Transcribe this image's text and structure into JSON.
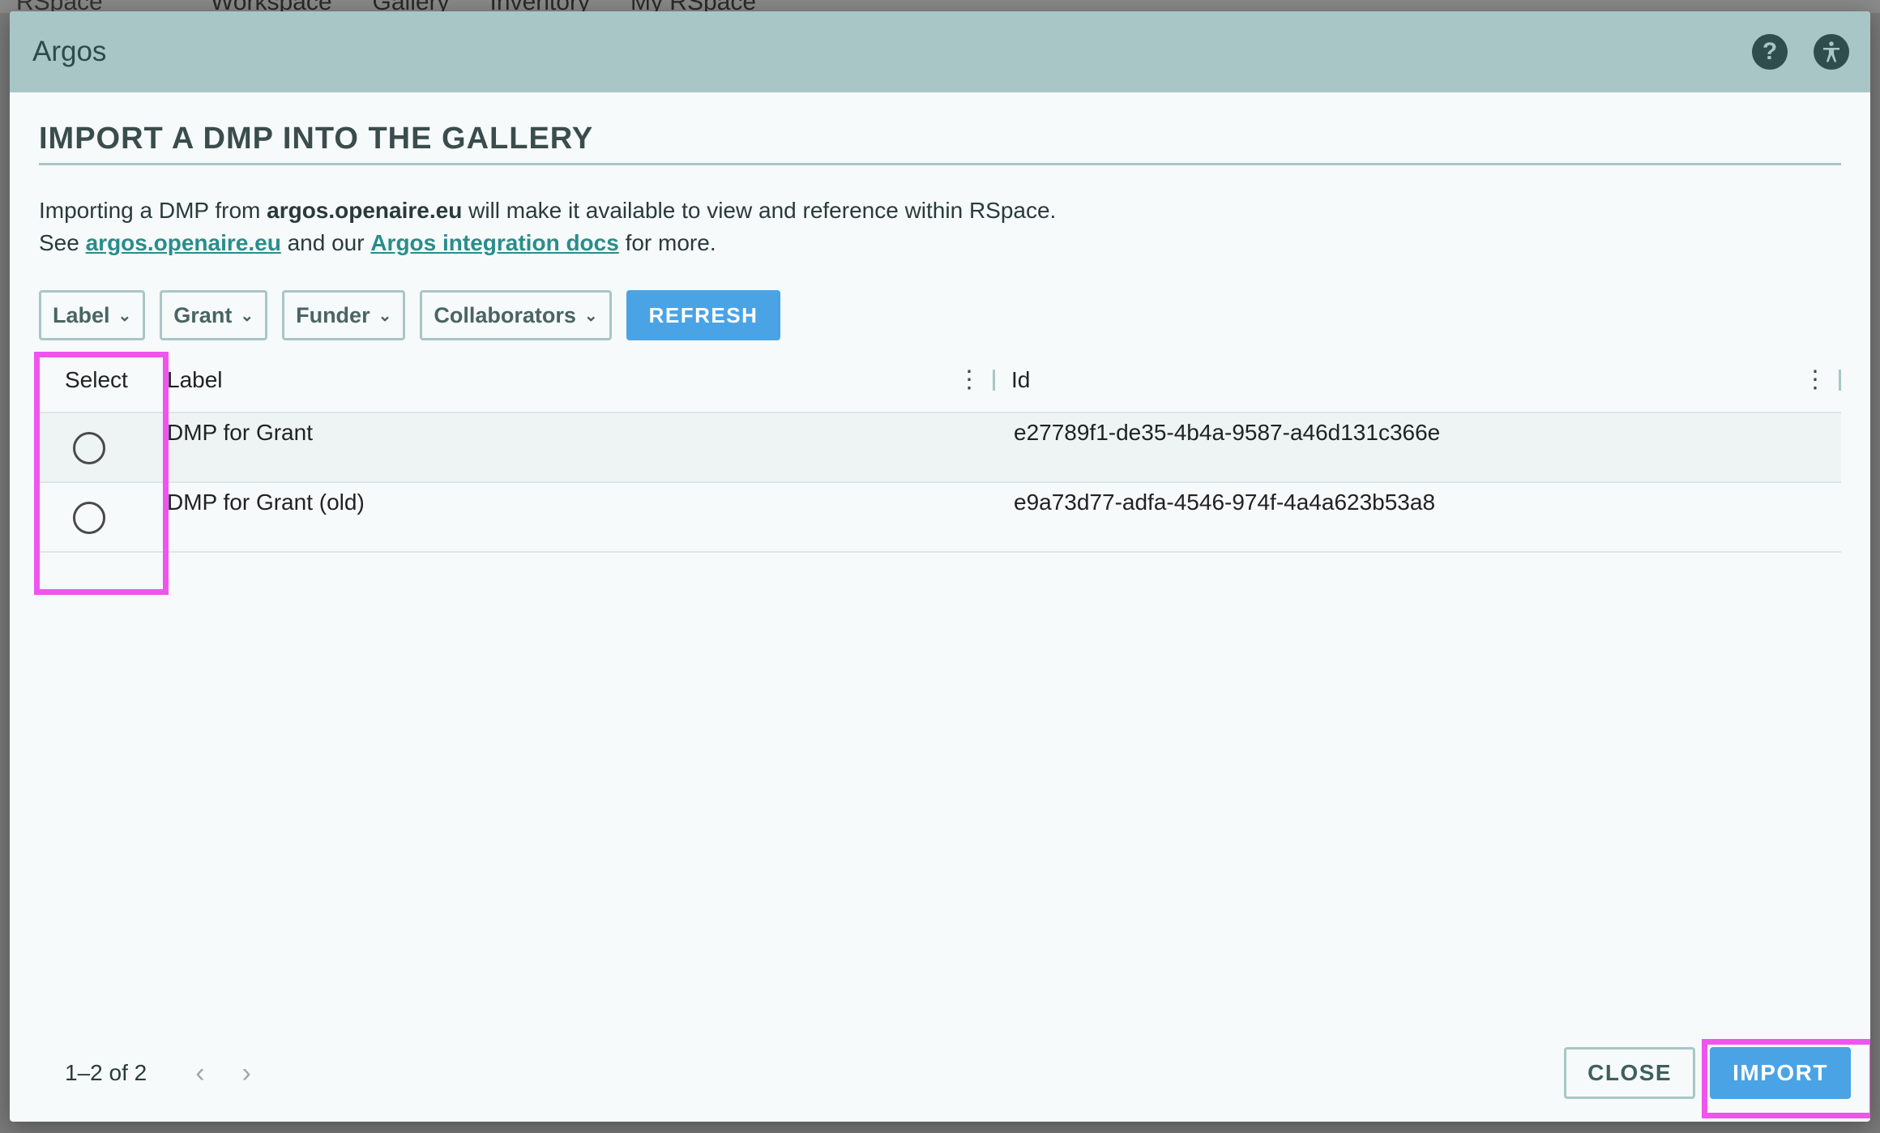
{
  "background": {
    "logo": "RSpace",
    "nav": [
      "Workspace",
      "Gallery",
      "Inventory",
      "My RSpace"
    ]
  },
  "dialog": {
    "title": "Argos",
    "help_icon": "help-icon",
    "accessibility_icon": "accessibility-icon",
    "heading": "IMPORT A DMP INTO THE GALLERY",
    "description": {
      "line1_pre": "Importing a DMP from ",
      "line1_bold": "argos.openaire.eu",
      "line1_post": " will make it available to view and reference within RSpace.",
      "line2_pre": "See ",
      "link1": "argos.openaire.eu",
      "line2_mid": " and our ",
      "link2": "Argos integration docs",
      "line2_post": " for more."
    },
    "filters": [
      {
        "label": "Label"
      },
      {
        "label": "Grant"
      },
      {
        "label": "Funder"
      },
      {
        "label": "Collaborators"
      }
    ],
    "refresh_label": "REFRESH",
    "table": {
      "columns": {
        "select": "Select",
        "label": "Label",
        "id": "Id"
      },
      "rows": [
        {
          "label": "DMP for Grant",
          "id": "e27789f1-de35-4b4a-9587-a46d131c366e"
        },
        {
          "label": "DMP for Grant (old)",
          "id": "e9a73d77-adfa-4546-974f-4a4a623b53a8"
        }
      ]
    },
    "pagination": {
      "text": "1–2 of 2",
      "prev": "‹",
      "next": "›"
    },
    "close_label": "CLOSE",
    "import_label": "IMPORT"
  },
  "colors": {
    "titlebar": "#a9c6c6",
    "primary_button": "#4aa3e4",
    "link": "#2a8c8c",
    "highlight": "#ee55ee"
  }
}
